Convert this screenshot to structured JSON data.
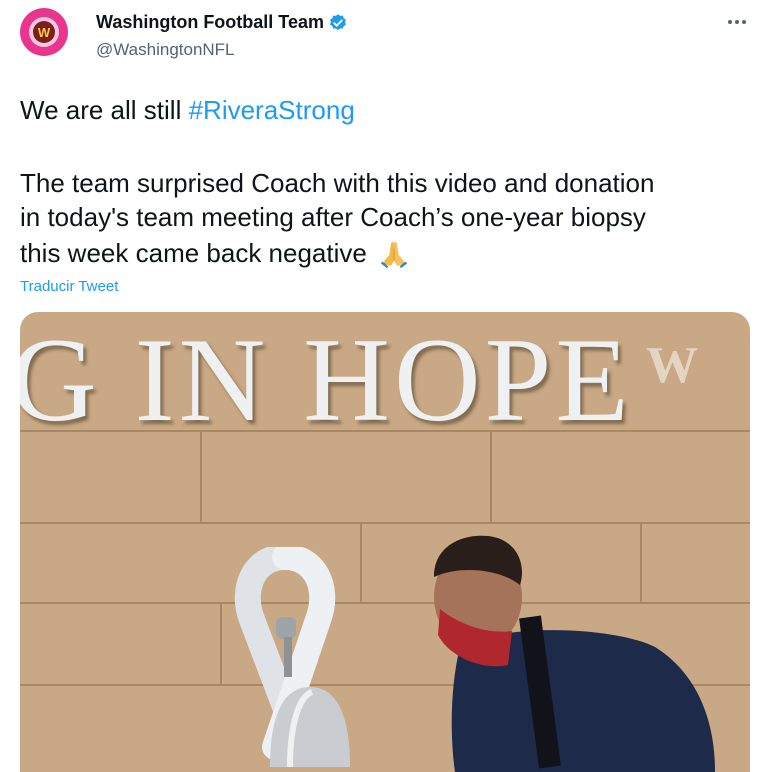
{
  "tweet": {
    "author_name": "Washington Football Team",
    "author_handle": "@WashingtonNFL",
    "avatar_letter": "W",
    "line1_prefix": "We are all still ",
    "line1_hashtag": "#RiveraStrong",
    "line2": "The team surprised Coach with this video and donation",
    "line3": "in today's team meeting after Coach’s one-year biopsy",
    "line4": "this week came back negative",
    "emoji": "folded-hands",
    "translate_link": "Traducir Tweet"
  },
  "media": {
    "wall_text": "G IN HOPE",
    "watermark": "W"
  },
  "colors": {
    "link": "#1d9bf0",
    "text": "#0f1419",
    "secondary": "#536471",
    "avatar_bg": "#e8368f"
  }
}
